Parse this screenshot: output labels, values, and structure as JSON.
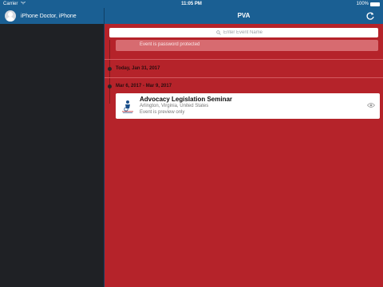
{
  "status_bar": {
    "carrier": "Carrier",
    "time": "11:05 PM",
    "battery": "100%",
    "battery_level": 1.0
  },
  "sidebar": {
    "user_name": "iPhone Doctor, iPhone",
    "avatar_icon": "user-avatar-icon"
  },
  "header": {
    "title": "PVA",
    "refresh_icon": "refresh-icon"
  },
  "search": {
    "placeholder": "Enter Event Name"
  },
  "timeline": {
    "partial_event_status": "Event is password protected",
    "today_label": "Today, Jan 31, 2017",
    "group_label": "Mar 6, 2017 - Mar 9, 2017"
  },
  "event": {
    "title": "Advocacy Legislation Seminar",
    "location": "Arlington, Virginia, United States",
    "status": "Event is preview only",
    "icon": "eye-icon"
  },
  "colors": {
    "header_blue": "#1a5f93",
    "main_red": "#b5232a",
    "sidebar_dark": "#1f2125"
  }
}
